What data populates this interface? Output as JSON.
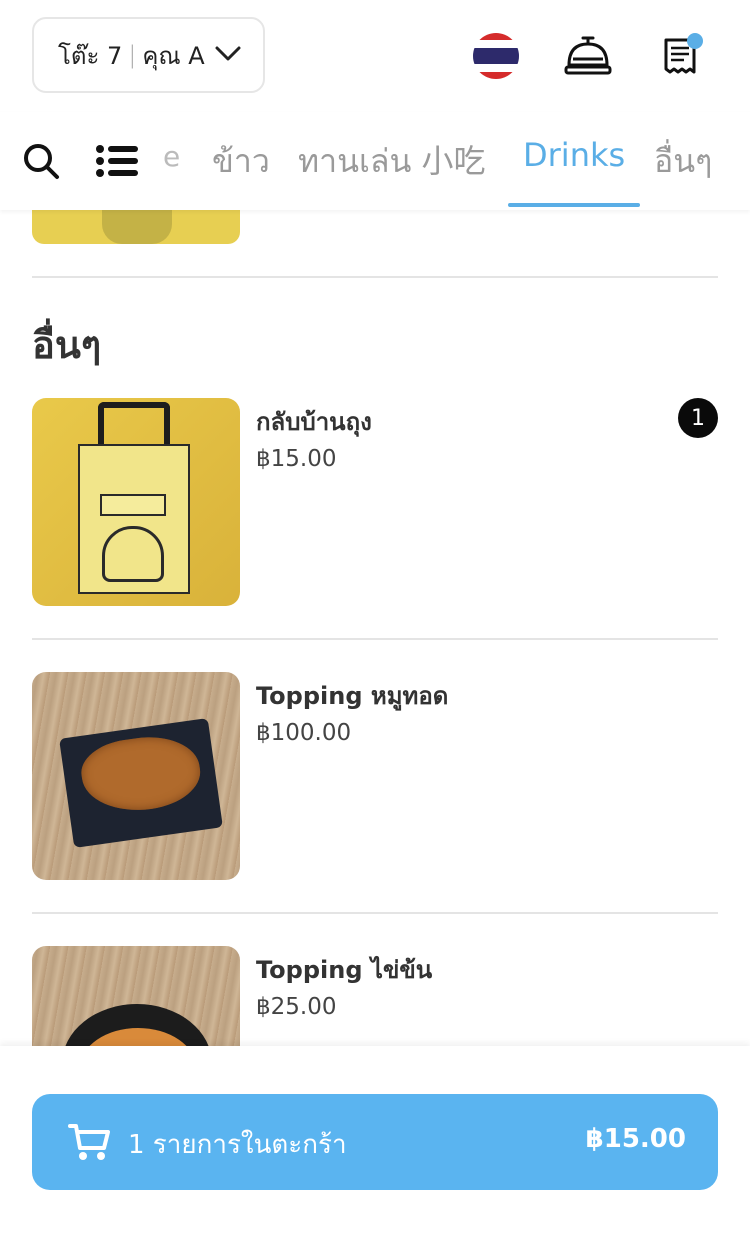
{
  "header": {
    "table_label": "โต๊ะ 7",
    "separator": "|",
    "customer_label": "คุณ A"
  },
  "colors": {
    "accent": "#5ab4f0",
    "tab_active": "#5aaee6",
    "badge": "#0a0a0a"
  },
  "icons": {
    "language": "thailand-flag-icon",
    "call_staff": "service-bell-icon",
    "bill": "receipt-icon",
    "search": "search-icon",
    "categories": "list-menu-icon",
    "cart": "cart-icon"
  },
  "tabs": {
    "partial_left": "e",
    "items": [
      {
        "label": "ข้าว",
        "active": false
      },
      {
        "label": "ทานเล่น 小吃",
        "active": false
      },
      {
        "label": "Drinks",
        "active": true
      },
      {
        "label": "อื่นๆ",
        "active": false
      }
    ]
  },
  "section": {
    "title": "อื่นๆ"
  },
  "menu_items": [
    {
      "name": "กลับบ้านถุง",
      "price": "฿15.00",
      "quantity": "1"
    },
    {
      "name": "Topping หมูทอด",
      "price": "฿100.00"
    },
    {
      "name": "Topping ไข่ข้น",
      "price": "฿25.00"
    }
  ],
  "cart": {
    "label": "1 รายการในตะกร้า",
    "total": "฿15.00"
  }
}
